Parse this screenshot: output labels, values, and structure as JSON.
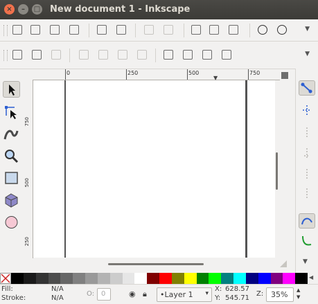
{
  "window": {
    "title": "New document 1 - Inkscape"
  },
  "toolbar1": {
    "buttons": [
      {
        "name": "new-document-icon",
        "enabled": true
      },
      {
        "name": "open-icon",
        "enabled": true
      },
      {
        "name": "save-icon",
        "enabled": true
      },
      {
        "name": "print-icon",
        "enabled": true
      },
      {
        "name": "import-icon",
        "enabled": true
      },
      {
        "name": "export-icon",
        "enabled": true
      },
      {
        "name": "undo-icon",
        "enabled": false
      },
      {
        "name": "redo-icon",
        "enabled": false
      },
      {
        "name": "copy-icon",
        "enabled": true
      },
      {
        "name": "cut-icon",
        "enabled": true
      },
      {
        "name": "paste-icon",
        "enabled": true
      },
      {
        "name": "zoom-selection-icon",
        "enabled": true
      },
      {
        "name": "zoom-drawing-icon",
        "enabled": true
      }
    ]
  },
  "toolbar2": {
    "buttons": [
      {
        "name": "select-all-icon",
        "enabled": true
      },
      {
        "name": "select-all-layers-icon",
        "enabled": true
      },
      {
        "name": "deselect-icon",
        "enabled": false
      },
      {
        "name": "rotate-ccw-icon",
        "enabled": false
      },
      {
        "name": "rotate-cw-icon",
        "enabled": false
      },
      {
        "name": "flip-horizontal-icon",
        "enabled": false
      },
      {
        "name": "flip-vertical-icon",
        "enabled": false
      },
      {
        "name": "raise-to-top-icon",
        "enabled": true
      },
      {
        "name": "raise-icon",
        "enabled": true
      },
      {
        "name": "lower-icon",
        "enabled": true
      },
      {
        "name": "lower-to-bottom-icon",
        "enabled": true
      }
    ]
  },
  "ruler": {
    "horizontal_labels": [
      "0",
      "250",
      "500",
      "750"
    ],
    "vertical_labels": [
      "750",
      "500",
      "250"
    ]
  },
  "tools": [
    {
      "name": "selector-tool-icon",
      "active": true
    },
    {
      "name": "node-tool-icon",
      "active": false
    },
    {
      "name": "tweak-tool-icon",
      "active": false
    },
    {
      "name": "zoom-tool-icon",
      "active": false
    },
    {
      "name": "rectangle-tool-icon",
      "active": false
    },
    {
      "name": "3d-box-tool-icon",
      "active": false
    },
    {
      "name": "ellipse-tool-icon",
      "active": false
    }
  ],
  "snap_bar": [
    {
      "name": "snap-toggle-icon",
      "on": true
    },
    {
      "name": "snap-bbox-icon",
      "on": false
    },
    {
      "name": "snap-bbox-edge-icon",
      "on": false
    },
    {
      "name": "snap-bbox-corner-icon",
      "on": false
    },
    {
      "name": "snap-bbox-midpoint-icon",
      "on": false
    },
    {
      "name": "snap-bbox-center-icon",
      "on": false
    },
    {
      "name": "snap-nodes-icon",
      "on": true
    },
    {
      "name": "snap-path-icon",
      "on": false
    }
  ],
  "palette": {
    "colors": [
      "#000000",
      "#1a1a1a",
      "#333333",
      "#4d4d4d",
      "#666666",
      "#808080",
      "#999999",
      "#b3b3b3",
      "#cccccc",
      "#e6e6e6",
      "#ffffff",
      "#800000",
      "#ff0000",
      "#808000",
      "#ffff00",
      "#008000",
      "#00ff00",
      "#008080",
      "#00ffff",
      "#000080",
      "#0000ff",
      "#800080",
      "#ff00ff",
      "#000000"
    ]
  },
  "status": {
    "fill_label": "Fill:",
    "fill_value": "N/A",
    "stroke_label": "Stroke:",
    "stroke_value": "N/A",
    "opacity_label": "O:",
    "opacity_value": "0",
    "layer": "•Layer 1",
    "x_label": "X:",
    "x_value": "628.57",
    "y_label": "Y:",
    "y_value": "545.71",
    "zoom_label": "Z:",
    "zoom_value": "35%"
  }
}
